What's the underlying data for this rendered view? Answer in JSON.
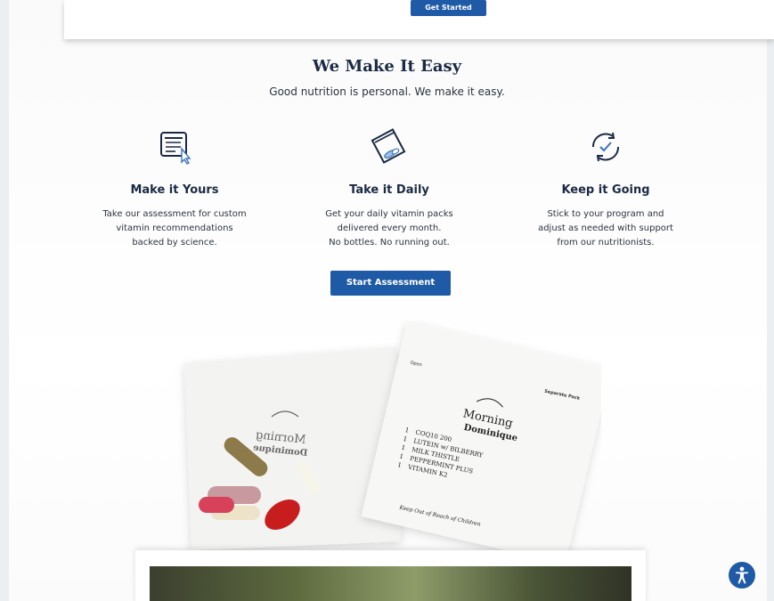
{
  "header": {
    "get_started_label": "Get Started"
  },
  "section": {
    "title": "We Make It Easy",
    "subtitle": "Good nutrition is personal. We make it easy."
  },
  "features": [
    {
      "icon": "checklist-cursor-icon",
      "title": "Make it Yours",
      "text": "Take our assessment for custom\nvitamin recommendations\nbacked by science."
    },
    {
      "icon": "vitamin-pack-icon",
      "title": "Take it Daily",
      "text": "Get your daily vitamin packs\ndelivered every month.\nNo bottles. No running out."
    },
    {
      "icon": "refresh-check-icon",
      "title": "Keep it Going",
      "text": "Stick to your program and\nadjust as needed with support\nfrom our nutritionists."
    }
  ],
  "cta": {
    "start_assessment_label": "Start Assessment"
  },
  "pack_back": {
    "label": "Morning",
    "name": "Dominique"
  },
  "pack_front": {
    "label": "Morning",
    "name": "Dominique",
    "open_label": "Open",
    "separate_label": "Separate Pack",
    "warning": "Keep Out of Reach of Children",
    "items": [
      {
        "qty": "1",
        "name": "COQ10 200"
      },
      {
        "qty": "1",
        "name": "LUTEIN w/ BILBERRY"
      },
      {
        "qty": "1",
        "name": "MILK THISTLE"
      },
      {
        "qty": "1",
        "name": "PEPPERMINT PLUS"
      },
      {
        "qty": "1",
        "name": "VITAMIN K2"
      }
    ]
  },
  "colors": {
    "primary": "#1f5aa6",
    "heading": "#1b2a44",
    "text": "#2a3340"
  },
  "accessibility": {
    "icon": "accessibility-icon"
  }
}
